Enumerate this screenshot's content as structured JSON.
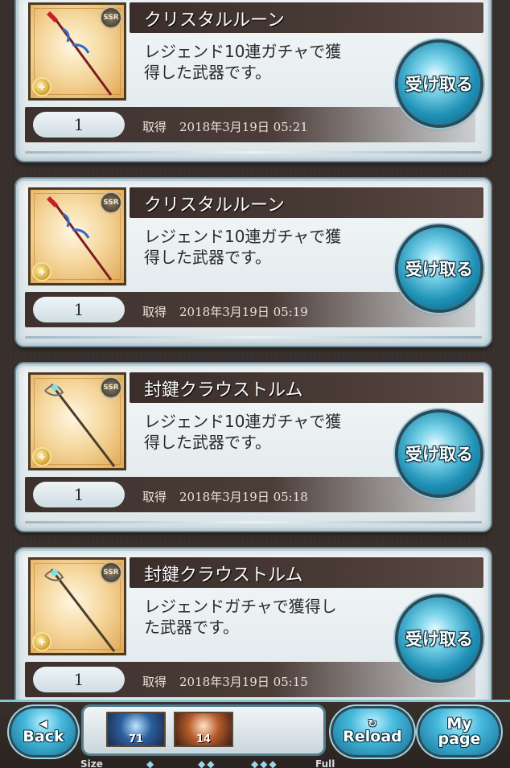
{
  "cards": [
    {
      "title": "クリスタルルーン",
      "description_line1": "レジェンド10連ガチャで獲",
      "description_line2": "得した武器です。",
      "quantity": "1",
      "acquired_label": "取得",
      "acquired_date": "2018年3月19日 05:21",
      "receive_label": "受け取る",
      "rarity": "SSR",
      "icon": "spear-icon"
    },
    {
      "title": "クリスタルルーン",
      "description_line1": "レジェンド10連ガチャで獲",
      "description_line2": "得した武器です。",
      "quantity": "1",
      "acquired_label": "取得",
      "acquired_date": "2018年3月19日 05:19",
      "receive_label": "受け取る",
      "rarity": "SSR",
      "icon": "spear-icon"
    },
    {
      "title": "封鍵クラウストルム",
      "description_line1": "レジェンド10連ガチャで獲",
      "description_line2": "得した武器です。",
      "quantity": "1",
      "acquired_label": "取得",
      "acquired_date": "2018年3月19日 05:18",
      "receive_label": "受け取る",
      "rarity": "SSR",
      "icon": "staff-icon"
    },
    {
      "title": "封鍵クラウストルム",
      "description_line1": "レジェンドガチャで獲得し",
      "description_line2": "た武器です。",
      "quantity": "1",
      "acquired_label": "取得",
      "acquired_date": "2018年3月19日 05:15",
      "receive_label": "受け取る",
      "rarity": "SSR",
      "icon": "staff-icon"
    }
  ],
  "footer": {
    "back_label": "Back",
    "reload_label": "Reload",
    "mypage_line1": "My",
    "mypage_line2": "page",
    "item1_count": "71",
    "item2_count": "14",
    "size_label": "Size",
    "full_label": "Full",
    "size_opt1": "◆",
    "size_opt2": "◆◆",
    "size_opt3": "◆◆◆"
  },
  "colors": {
    "accent": "#1f91b6",
    "titlebar": "#3b2e2a",
    "card": "#e8eef1"
  }
}
